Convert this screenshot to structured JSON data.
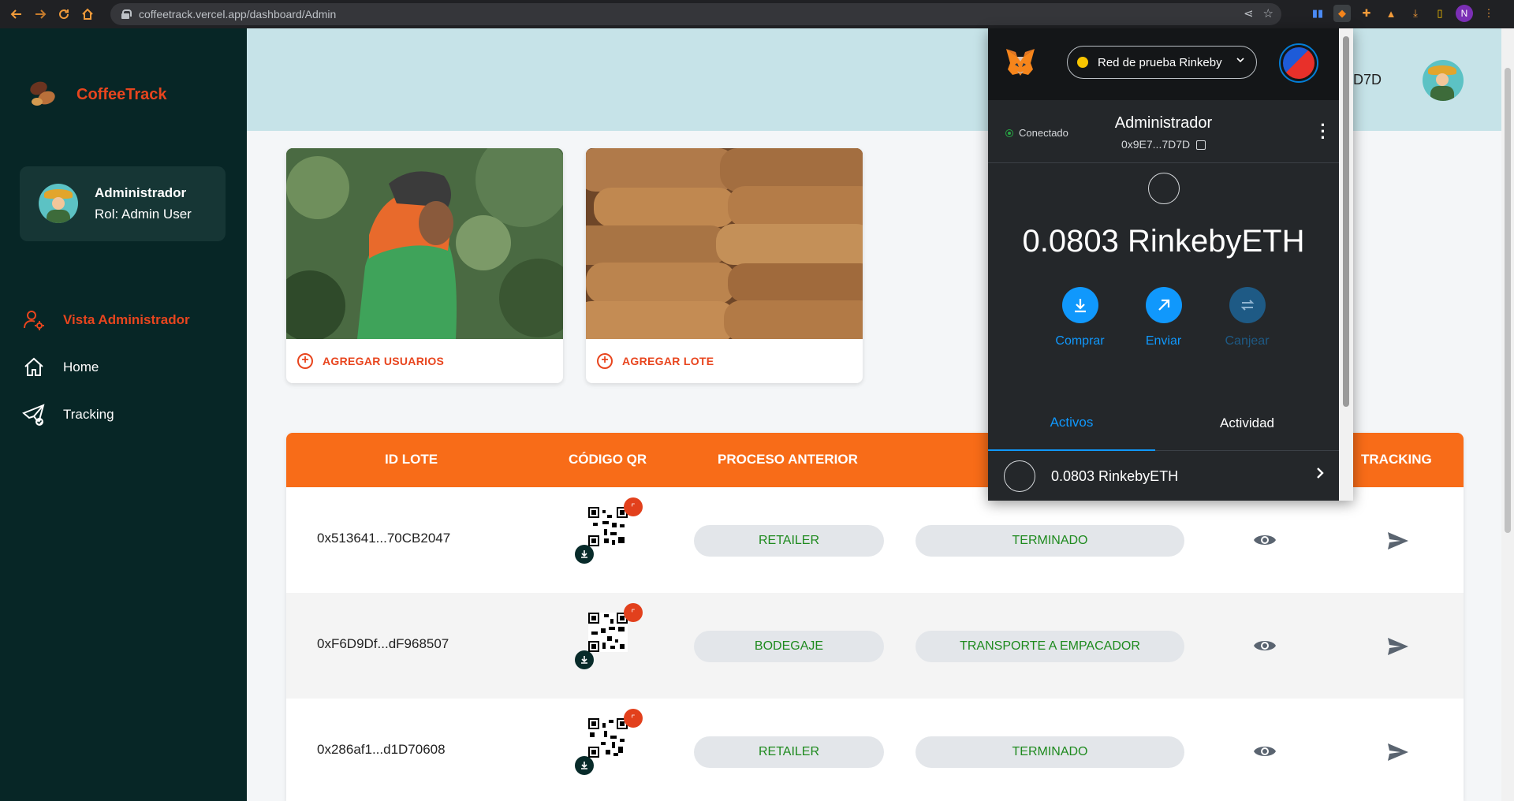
{
  "browser": {
    "url": "coffeetrack.vercel.app/dashboard/Admin",
    "profile_initial": "N"
  },
  "sidebar": {
    "brand": "CoffeeTrack",
    "user": {
      "name": "Administrador",
      "role": "Rol: Admin User"
    },
    "items": [
      {
        "label": "Vista Administrador",
        "icon": "user-gear-icon",
        "active": true
      },
      {
        "label": "Home",
        "icon": "home-icon",
        "active": false
      },
      {
        "label": "Tracking",
        "icon": "paper-plane-icon",
        "active": false
      }
    ]
  },
  "header": {
    "address_suffix": "D7D"
  },
  "cards": [
    {
      "action_label": "AGREGAR USUARIOS",
      "image": "farmer-photo"
    },
    {
      "action_label": "AGREGAR LOTE",
      "image": "coffee-bags-photo"
    }
  ],
  "table": {
    "headers": [
      "ID LOTE",
      "CÓDIGO QR",
      "PROCESO ANTERIOR",
      "TRACKING"
    ],
    "rows": [
      {
        "id": "0x513641...70CB2047",
        "prev": "RETAILER",
        "status": "TERMINADO"
      },
      {
        "id": "0xF6D9Df...dF968507",
        "prev": "BODEGAJE",
        "status": "TRANSPORTE A EMPACADOR"
      },
      {
        "id": "0x286af1...d1D70608",
        "prev": "RETAILER",
        "status": "TERMINADO"
      }
    ]
  },
  "metamask": {
    "network": "Red de prueba Rinkeby",
    "connection": "Conectado",
    "account_name": "Administrador",
    "account_address": "0x9E7...7D7D",
    "balance": "0.0803 RinkebyETH",
    "actions": [
      {
        "label": "Comprar",
        "icon": "download-icon",
        "enabled": true
      },
      {
        "label": "Enviar",
        "icon": "arrow-up-right-icon",
        "enabled": true
      },
      {
        "label": "Canjear",
        "icon": "swap-icon",
        "enabled": false
      }
    ],
    "tabs": [
      "Activos",
      "Actividad"
    ],
    "asset": "0.0803 RinkebyETH"
  },
  "colors": {
    "sidebar_bg": "#072626",
    "accent_orange": "#f86c18",
    "brand_red": "#e8451e",
    "header_bg": "#c6e3e8",
    "metamask_blue": "#1098fc"
  }
}
